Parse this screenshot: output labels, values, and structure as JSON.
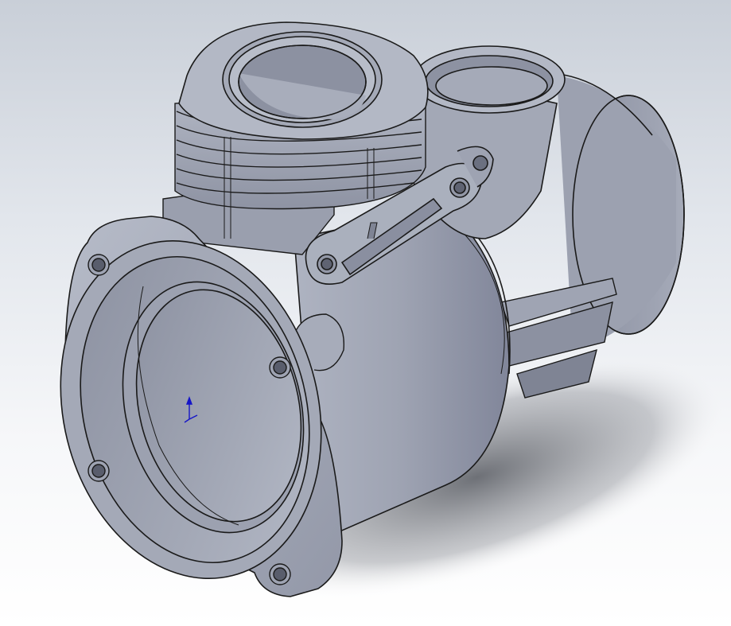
{
  "viewport": {
    "background_top": "#c9cfd8",
    "background_bottom": "#ffffff"
  },
  "model": {
    "part_color": "#a9aebc",
    "part_shade": "#7f8494",
    "edge_color": "#1a1a1a",
    "shadow_color": "#6a6d75"
  },
  "triad": {
    "icon": "coordinate-triad-icon",
    "axis_color": "#1515c8"
  }
}
